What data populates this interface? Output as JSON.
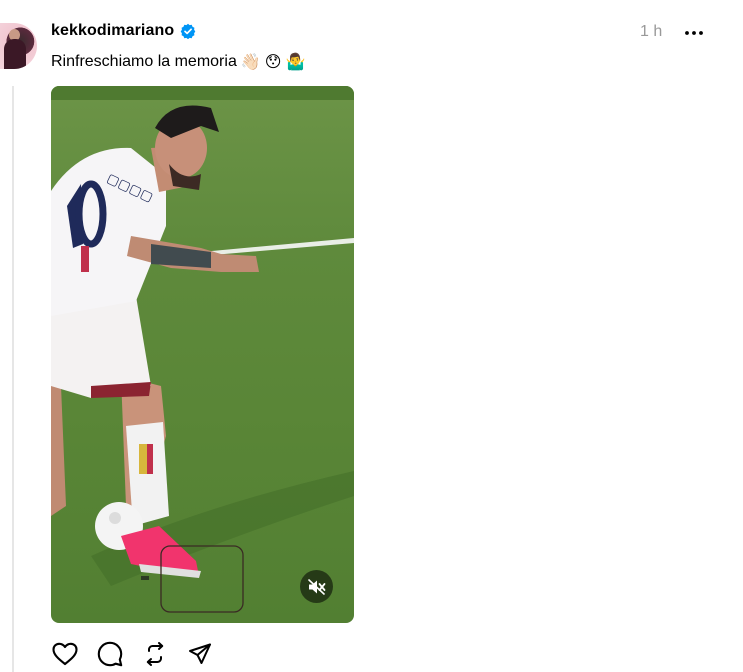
{
  "post": {
    "username": "kekkodimariano",
    "verified": true,
    "time": "1 h",
    "caption_text": "Rinfreschiamo la memoria",
    "caption_emojis": [
      "👋🏻",
      "😯",
      "🤷‍♂️"
    ]
  },
  "media": {
    "muted": true
  },
  "icons": {
    "more": "more-horizontal-icon",
    "verified": "verified-badge-icon",
    "like": "heart-icon",
    "comment": "comment-icon",
    "repost": "repost-icon",
    "share": "send-icon",
    "mute": "volume-muted-icon"
  },
  "colors": {
    "verified_blue": "#0095f6",
    "time_gray": "#999999",
    "thread_line": "#e6e6e6"
  }
}
